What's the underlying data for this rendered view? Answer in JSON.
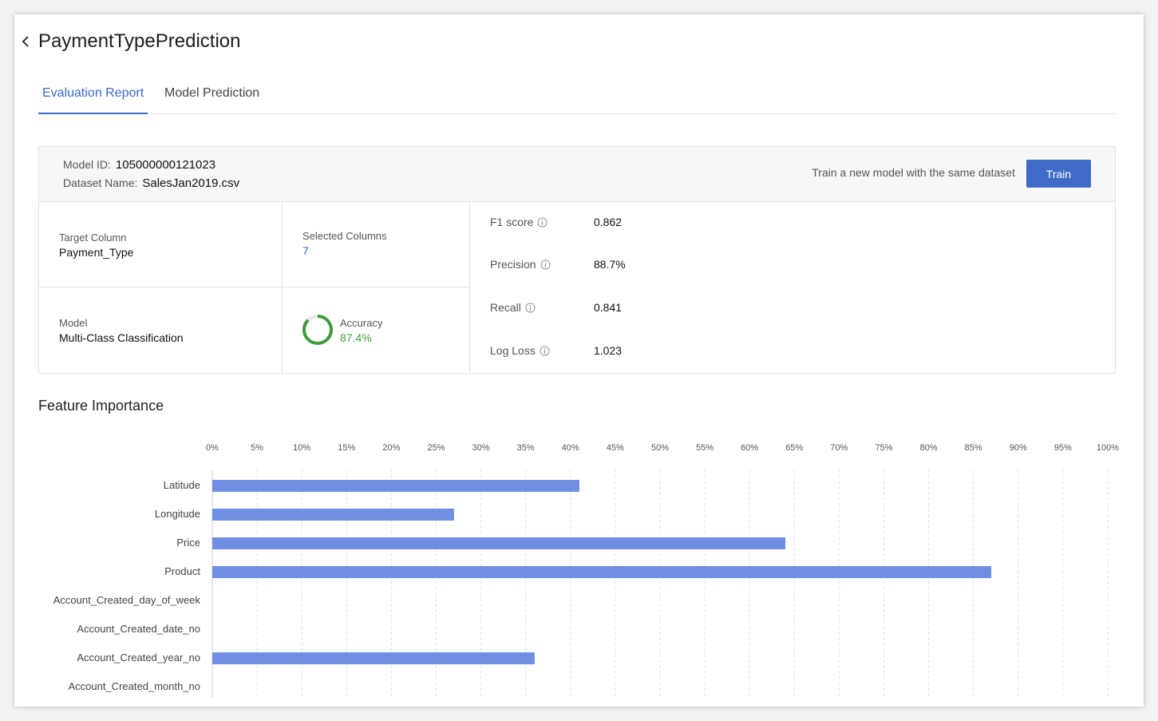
{
  "header": {
    "title": "PaymentTypePrediction",
    "back_icon": "chevron-left-icon"
  },
  "tabs": [
    {
      "label": "Evaluation Report",
      "active": true
    },
    {
      "label": "Model Prediction",
      "active": false
    }
  ],
  "summary": {
    "model_id_label": "Model ID:",
    "model_id": "105000000121023",
    "dataset_label": "Dataset Name:",
    "dataset_name": "SalesJan2019.csv",
    "train_hint": "Train a new model with the same dataset",
    "train_label": "Train",
    "target_column_label": "Target Column",
    "target_column": "Payment_Type",
    "selected_columns_label": "Selected Columns",
    "selected_columns": "7",
    "model_label": "Model",
    "model": "Multi-Class Classification",
    "accuracy_label": "Accuracy",
    "accuracy": "87.4%",
    "accuracy_fraction": 0.874,
    "metrics": [
      {
        "label": "F1 score",
        "value": "0.862"
      },
      {
        "label": "Precision",
        "value": "88.7%"
      },
      {
        "label": "Recall",
        "value": "0.841"
      },
      {
        "label": "Log Loss",
        "value": "1.023"
      }
    ]
  },
  "colors": {
    "accent": "#3b68cc",
    "button": "#3f6ac6",
    "bar": "#6f8fe3",
    "accuracy_ring": "#3f9b3b",
    "link_number": "#3b68cc"
  },
  "feature_importance": {
    "title": "Feature Importance",
    "chart_data": {
      "type": "bar",
      "orientation": "horizontal",
      "categories": [
        "Latitude",
        "Longitude",
        "Price",
        "Product",
        "Account_Created_day_of_week",
        "Account_Created_date_no",
        "Account_Created_year_no",
        "Account_Created_month_no"
      ],
      "values": [
        41,
        27,
        64,
        87,
        0,
        0,
        36,
        0
      ],
      "xlim": [
        0,
        100
      ],
      "x_ticks": [
        "0%",
        "5%",
        "10%",
        "15%",
        "20%",
        "25%",
        "30%",
        "35%",
        "40%",
        "45%",
        "50%",
        "55%",
        "60%",
        "65%",
        "70%",
        "75%",
        "80%",
        "85%",
        "90%",
        "95%",
        "100%"
      ],
      "grid": true,
      "legend": "none"
    }
  }
}
